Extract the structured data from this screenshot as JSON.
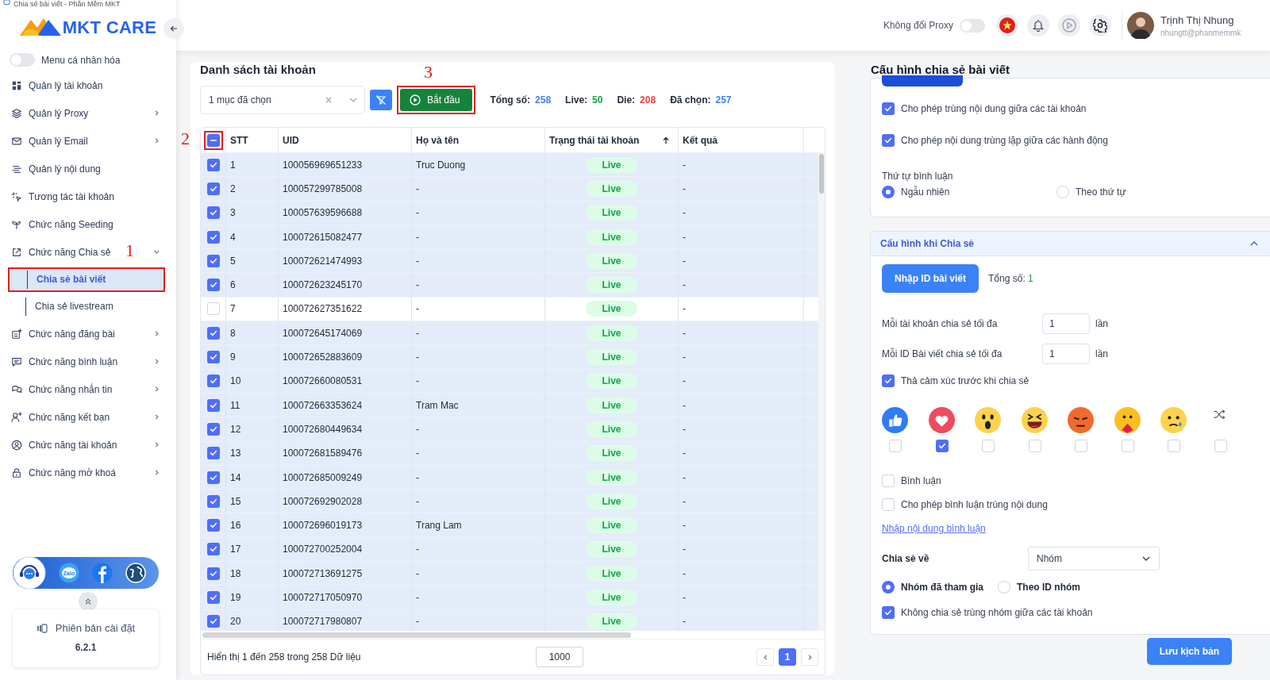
{
  "window": {
    "title": "Chia sẻ bài viết - Phần Mềm MKT"
  },
  "sidebar": {
    "logo": "MKT CARE",
    "personal_menu": {
      "label": "Menu cá nhân hóa",
      "on": false
    },
    "items": [
      {
        "kind": "link",
        "label": "Quản lý tài khoản"
      },
      {
        "kind": "group",
        "label": "Quản lý Proxy",
        "expanded": false
      },
      {
        "kind": "group",
        "label": "Quản lý Email",
        "expanded": false
      },
      {
        "kind": "link",
        "label": "Quản lý nội dung"
      },
      {
        "kind": "link",
        "label": "Tương tác tài khoản"
      },
      {
        "kind": "link",
        "label": "Chức năng Seeding"
      },
      {
        "kind": "group",
        "label": "Chức năng Chia sẻ",
        "expanded": true,
        "annotation": "1",
        "children": [
          {
            "label": "Chia sẻ bài viết",
            "selected": true,
            "outlined": true
          },
          {
            "label": "Chia sẻ livestream",
            "selected": false,
            "outlined": false
          }
        ]
      },
      {
        "kind": "group",
        "label": "Chức năng đăng bài",
        "expanded": false
      },
      {
        "kind": "group",
        "label": "Chức năng bình luận",
        "expanded": false
      },
      {
        "kind": "group",
        "label": "Chức năng nhắn tin",
        "expanded": false
      },
      {
        "kind": "group",
        "label": "Chức năng kết bạn",
        "expanded": false
      },
      {
        "kind": "group",
        "label": "Chức năng tài khoản",
        "expanded": false
      },
      {
        "kind": "group",
        "label": "Chức năng mở khoá",
        "expanded": false
      }
    ],
    "support_bar": {
      "zalo_label": "Zalo"
    },
    "version": {
      "label": "Phiên bản cài đặt",
      "value": "6.2.1"
    }
  },
  "header": {
    "proxy_toggle": {
      "label": "Không đổi Proxy",
      "on": false
    },
    "user": {
      "name": "Trịnh Thị Nhung",
      "email": "nhungtt@phanmemmk"
    }
  },
  "accounts": {
    "title": "Danh sách tài khoản",
    "filter": {
      "value": "1 mục đã chọn"
    },
    "start_button": {
      "label": "Bắt đầu",
      "annotation": "3",
      "outlined": true
    },
    "stats": [
      {
        "label": "Tổng số:",
        "value": "258",
        "color": "#3b82f6"
      },
      {
        "label": "Live:",
        "value": "50",
        "color": "#16a34a"
      },
      {
        "label": "Die:",
        "value": "208",
        "color": "#ef4444"
      },
      {
        "label": "Đã chọn:",
        "value": "257",
        "color": "#3b82f6"
      }
    ],
    "select_all": {
      "indeterminate": true,
      "annotation": "2",
      "outlined": true
    },
    "columns": [
      {
        "label": "STT"
      },
      {
        "label": "UID"
      },
      {
        "label": "Họ và tên"
      },
      {
        "label": "Trạng thái tài khoản",
        "sorted_ascending": true
      },
      {
        "label": "Kết quả"
      }
    ],
    "rows": [
      {
        "selected": true,
        "stt": "1",
        "uid": "100056969651233",
        "name": "Truc Duong",
        "status": "Live",
        "result": "-"
      },
      {
        "selected": true,
        "stt": "2",
        "uid": "100057299785008",
        "name": "-",
        "status": "Live",
        "result": "-"
      },
      {
        "selected": true,
        "stt": "3",
        "uid": "100057639596688",
        "name": "-",
        "status": "Live",
        "result": "-"
      },
      {
        "selected": true,
        "stt": "4",
        "uid": "100072615082477",
        "name": "-",
        "status": "Live",
        "result": "-"
      },
      {
        "selected": true,
        "stt": "5",
        "uid": "100072621474993",
        "name": "-",
        "status": "Live",
        "result": "-"
      },
      {
        "selected": true,
        "stt": "6",
        "uid": "100072623245170",
        "name": "-",
        "status": "Live",
        "result": "-"
      },
      {
        "selected": false,
        "stt": "7",
        "uid": "100072627351622",
        "name": "-",
        "status": "Live",
        "result": "-"
      },
      {
        "selected": true,
        "stt": "8",
        "uid": "100072645174069",
        "name": "-",
        "status": "Live",
        "result": "-"
      },
      {
        "selected": true,
        "stt": "9",
        "uid": "100072652883609",
        "name": "-",
        "status": "Live",
        "result": "-"
      },
      {
        "selected": true,
        "stt": "10",
        "uid": "100072660080531",
        "name": "-",
        "status": "Live",
        "result": "-"
      },
      {
        "selected": true,
        "stt": "11",
        "uid": "100072663353624",
        "name": "Tram Mac",
        "status": "Live",
        "result": "-"
      },
      {
        "selected": true,
        "stt": "12",
        "uid": "100072680449634",
        "name": "-",
        "status": "Live",
        "result": "-"
      },
      {
        "selected": true,
        "stt": "13",
        "uid": "100072681589476",
        "name": "-",
        "status": "Live",
        "result": "-"
      },
      {
        "selected": true,
        "stt": "14",
        "uid": "100072685009249",
        "name": "-",
        "status": "Live",
        "result": "-"
      },
      {
        "selected": true,
        "stt": "15",
        "uid": "100072692902028",
        "name": "-",
        "status": "Live",
        "result": "-"
      },
      {
        "selected": true,
        "stt": "16",
        "uid": "100072696019173",
        "name": "Trang Lam",
        "status": "Live",
        "result": "-"
      },
      {
        "selected": true,
        "stt": "17",
        "uid": "100072700252004",
        "name": "-",
        "status": "Live",
        "result": "-"
      },
      {
        "selected": true,
        "stt": "18",
        "uid": "100072713691275",
        "name": "-",
        "status": "Live",
        "result": "-"
      },
      {
        "selected": true,
        "stt": "19",
        "uid": "100072717050970",
        "name": "-",
        "status": "Live",
        "result": "-"
      },
      {
        "selected": true,
        "stt": "20",
        "uid": "100072717980807",
        "name": "-",
        "status": "Live",
        "result": "-"
      }
    ],
    "footer": {
      "info": "Hiển thị 1 đến 258 trong 258 Dữ liệu",
      "page_size": "1000",
      "pages": [
        {
          "label": "1",
          "selected": true
        }
      ]
    }
  },
  "config": {
    "title": "Cấu hình chia sẻ bài viết",
    "options": [
      {
        "label": "Cho phép trùng nội dung giữa các tài khoản",
        "checked": true
      },
      {
        "label": "Cho phép nội dung trùng lặp giữa các hành động",
        "checked": true
      }
    ],
    "comment_order": {
      "label": "Thứ tự bình luận",
      "options": [
        {
          "label": "Ngẫu nhiên",
          "selected": true
        },
        {
          "label": "Theo thứ tự",
          "selected": false
        }
      ]
    },
    "share_section": {
      "title": "Cấu hình khi Chia sẻ",
      "expanded": true,
      "import_button": "Nhập ID bài viết",
      "total": {
        "label": "Tổng số:",
        "value": "1"
      },
      "limits": [
        {
          "label": "Mỗi tài khoản chia sẻ tối đa",
          "value": "1",
          "unit": "lần"
        },
        {
          "label": "Mỗi ID Bài viết chia sẻ tối đa",
          "value": "1",
          "unit": "lần"
        }
      ],
      "react": {
        "label": "Thả cảm xúc trước khi chia sẻ",
        "checked": true
      },
      "reactions": [
        {
          "kind": "like",
          "checked": false
        },
        {
          "kind": "love",
          "checked": true
        },
        {
          "kind": "wow",
          "checked": false
        },
        {
          "kind": "haha",
          "checked": false
        },
        {
          "kind": "angry",
          "checked": false
        },
        {
          "kind": "care",
          "checked": false
        },
        {
          "kind": "sad",
          "checked": false
        },
        {
          "kind": "random",
          "checked": false
        }
      ],
      "comment_options": [
        {
          "label": "Bình luận",
          "checked": false
        },
        {
          "label": "Cho phép bình luận trùng nội dung",
          "checked": false
        }
      ],
      "comment_link": "Nhập nội dung bình luận",
      "share_to": {
        "label": "Chia sẻ về",
        "value": "Nhóm"
      },
      "targets": [
        {
          "label": "Nhóm đã tham gia",
          "selected": true
        },
        {
          "label": "Theo ID nhóm",
          "selected": false
        }
      ],
      "no_duplicate": {
        "label": "Không chia sẻ trùng nhóm giữa các tài khoản",
        "checked": true
      }
    },
    "save_button": "Lưu kịch bản"
  }
}
